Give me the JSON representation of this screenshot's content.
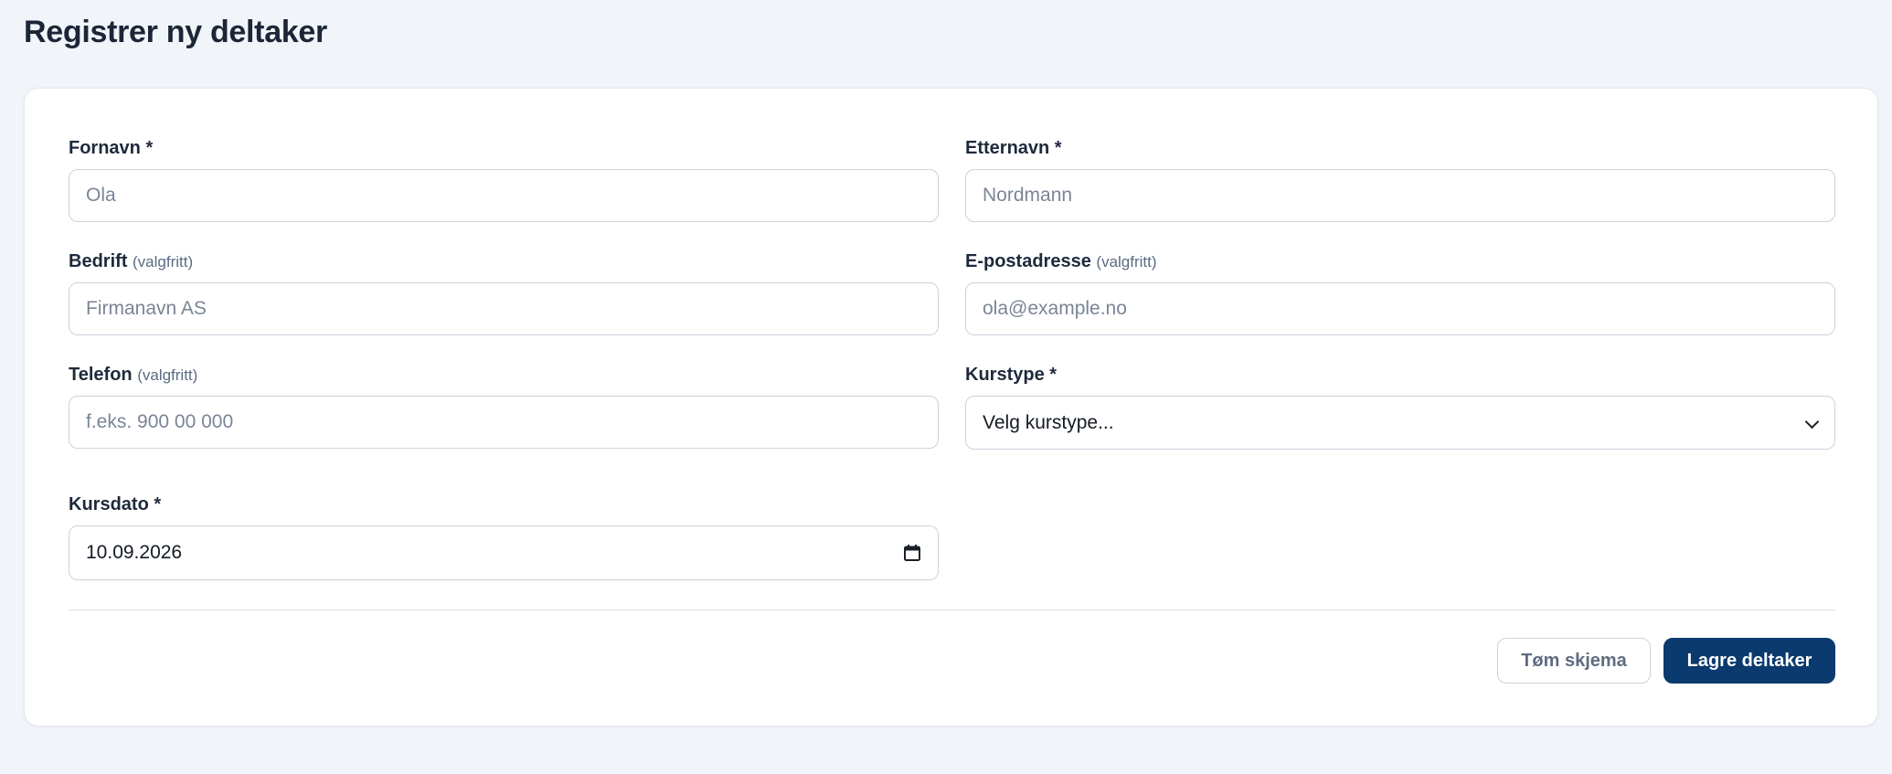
{
  "page": {
    "title": "Registrer ny deltaker"
  },
  "form": {
    "first_name": {
      "label": "Fornavn *",
      "placeholder": "Ola",
      "value": ""
    },
    "last_name": {
      "label": "Etternavn *",
      "placeholder": "Nordmann",
      "value": ""
    },
    "company": {
      "label": "Bedrift",
      "optional": "(valgfritt)",
      "placeholder": "Firmanavn AS",
      "value": ""
    },
    "email": {
      "label": "E-postadresse",
      "optional": "(valgfritt)",
      "placeholder": "ola@example.no",
      "value": ""
    },
    "phone": {
      "label": "Telefon",
      "optional": "(valgfritt)",
      "placeholder": "f.eks. 900 00 000",
      "value": ""
    },
    "course_type": {
      "label": "Kurstype *",
      "selected": "Velg kurstype..."
    },
    "course_date": {
      "label": "Kursdato *",
      "value": "10.09.2026"
    }
  },
  "actions": {
    "clear_label": "Tøm skjema",
    "save_label": "Lagre deltaker"
  },
  "colors": {
    "background": "#f1f4f9",
    "primary": "#0b3a6e",
    "border": "#ccd3de",
    "text": "#1e2a3b",
    "muted": "#5b6b82"
  },
  "icons": {
    "select": "chevron-down-icon",
    "date": "calendar-icon"
  }
}
